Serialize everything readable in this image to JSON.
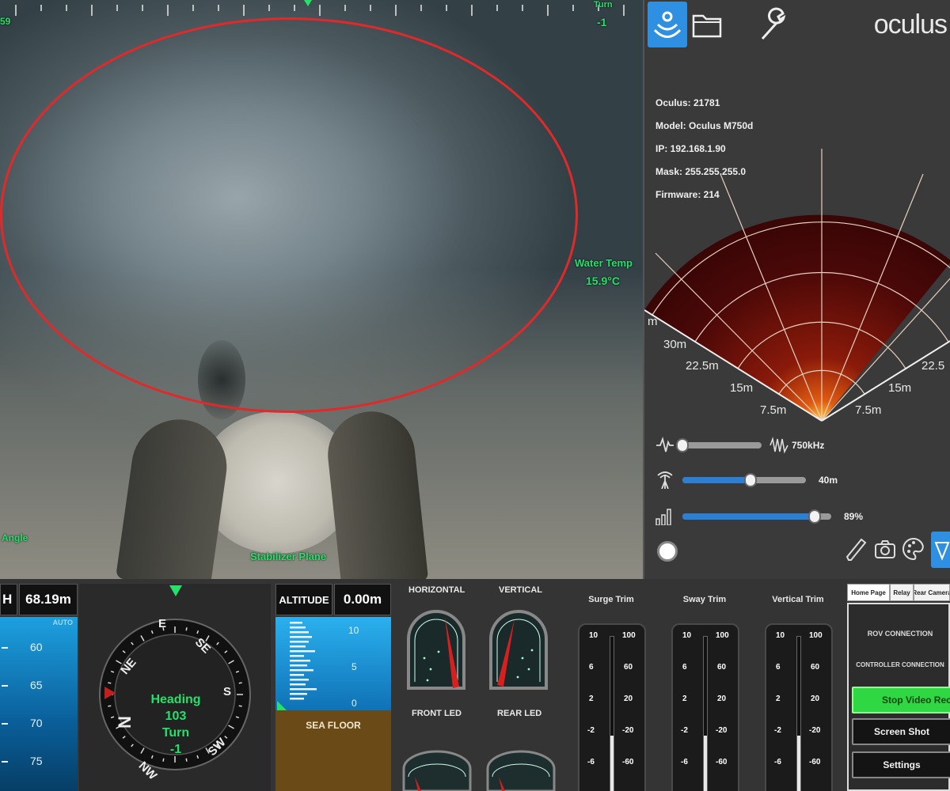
{
  "camera": {
    "top_left_value": "59",
    "turn_label": "Turn",
    "turn_value": "-1",
    "water_temp_label": "Water Temp",
    "water_temp_value": "15.9°C",
    "angle_label": "Angle",
    "bottom_label": "Stabilizer Plane"
  },
  "sonar": {
    "brand": "oculus",
    "device_info": {
      "serial": "Oculus: 21781",
      "model": "Model: Oculus M750d",
      "ip": "IP: 192.168.1.90",
      "mask": "Mask: 255.255.255.0",
      "firmware": "Firmware: 214"
    },
    "ranges": {
      "r30": "30m",
      "r22_left": "22.5m",
      "r22_right": "22.5",
      "r15_left": "15m",
      "r15_right": "15m",
      "r7_left": "7.5m",
      "r7_right": "7.5m",
      "edge_m": "m"
    },
    "sliders": [
      {
        "name": "frequency",
        "value_label": "750kHz",
        "level": 0
      },
      {
        "name": "range",
        "value_label": "40m",
        "level": 0.55
      },
      {
        "name": "gain",
        "value_label": "89%",
        "level": 0.89
      }
    ]
  },
  "dashboard": {
    "depth": {
      "header_left": "H",
      "value": "68.19m",
      "auto": "AUTO",
      "scale": [
        "60",
        "65",
        "70",
        "75"
      ]
    },
    "compass": {
      "heading_label": "Heading",
      "heading_value": "103",
      "turn_label": "Turn",
      "turn_value": "-1",
      "dirs": {
        "e": "E",
        "se": "SE",
        "s": "S",
        "sw": "SW",
        "nw": "NW",
        "n": "N",
        "ne": "NE"
      }
    },
    "altitude": {
      "label": "ALTITUDE",
      "value": "0.00m",
      "scale": [
        "10",
        "5",
        "0"
      ],
      "seafloor": "SEA FLOOR"
    },
    "gauges": {
      "horizontal": "HORIZONTAL",
      "vertical": "VERTICAL",
      "front_led": "FRONT LED",
      "rear_led": "REAR LED"
    },
    "trims": [
      {
        "title": "Surge Trim",
        "left": [
          "10",
          "6",
          "2",
          "-2",
          "-6"
        ],
        "right": [
          "100",
          "60",
          "20",
          "-20",
          "-60"
        ],
        "level": 0.38
      },
      {
        "title": "Sway Trim",
        "left": [
          "10",
          "6",
          "2",
          "-2",
          "-6"
        ],
        "right": [
          "100",
          "60",
          "20",
          "-20",
          "-60"
        ],
        "level": 0.38
      },
      {
        "title": "Vertical Trim",
        "left": [
          "10",
          "6",
          "2",
          "-2",
          "-6"
        ],
        "right": [
          "100",
          "60",
          "20",
          "-20",
          "-60"
        ],
        "level": 0.38
      }
    ],
    "side": {
      "tabs": [
        "Home Page",
        "Relay",
        "Rear Camera"
      ],
      "rov_connection": "ROV CONNECTION",
      "controller_connection": "CONTROLLER CONNECTION",
      "stop_video": "Stop Video Recording",
      "screenshot": "Screen Shot",
      "settings": "Settings"
    }
  },
  "colors": {
    "overlay_green": "#27e06a",
    "sonar_accent": "#2f8fe0",
    "record_green": "#2fd842",
    "ellipse_red": "#e02a2a"
  }
}
